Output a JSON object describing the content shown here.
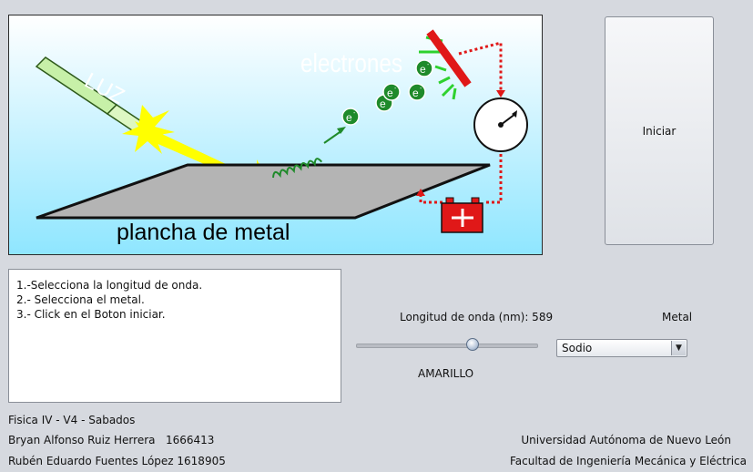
{
  "diagram": {
    "labels": {
      "light": "LUZ",
      "electrons": "electrones",
      "plate": "plancha de metal",
      "electron_symbol": "e",
      "electron_superscript": "-"
    },
    "colors": {
      "sky": "#8fe6ff",
      "beam": "#ffff00",
      "plate": "#b4b4b4",
      "collector": "#e01818",
      "battery": "#e01818",
      "electron": "#1f8a2a"
    }
  },
  "start_button": {
    "label": "Iniciar"
  },
  "instructions": {
    "lines": [
      "1.-Selecciona la longitud de onda.",
      "2.- Selecciona el metal.",
      "3.- Click en el Boton iniciar."
    ]
  },
  "controls": {
    "wavelength_label": "Longitud de onda (nm): 589",
    "wavelength_nm": 589,
    "slider_fraction": 0.64,
    "color_name": "AMARILLO",
    "metal_label": "Metal",
    "metal_selected": "Sodio"
  },
  "footer": {
    "course": "Fisica IV - V4 - Sabados",
    "student1_name": "Bryan Alfonso Ruiz Herrera",
    "student1_id": "1666413",
    "student2": "Rubén Eduardo Fuentes López 1618905",
    "university": "Universidad Autónoma de Nuevo León",
    "faculty": "Facultad de Ingeniería Mecánica y Eléctrica"
  }
}
